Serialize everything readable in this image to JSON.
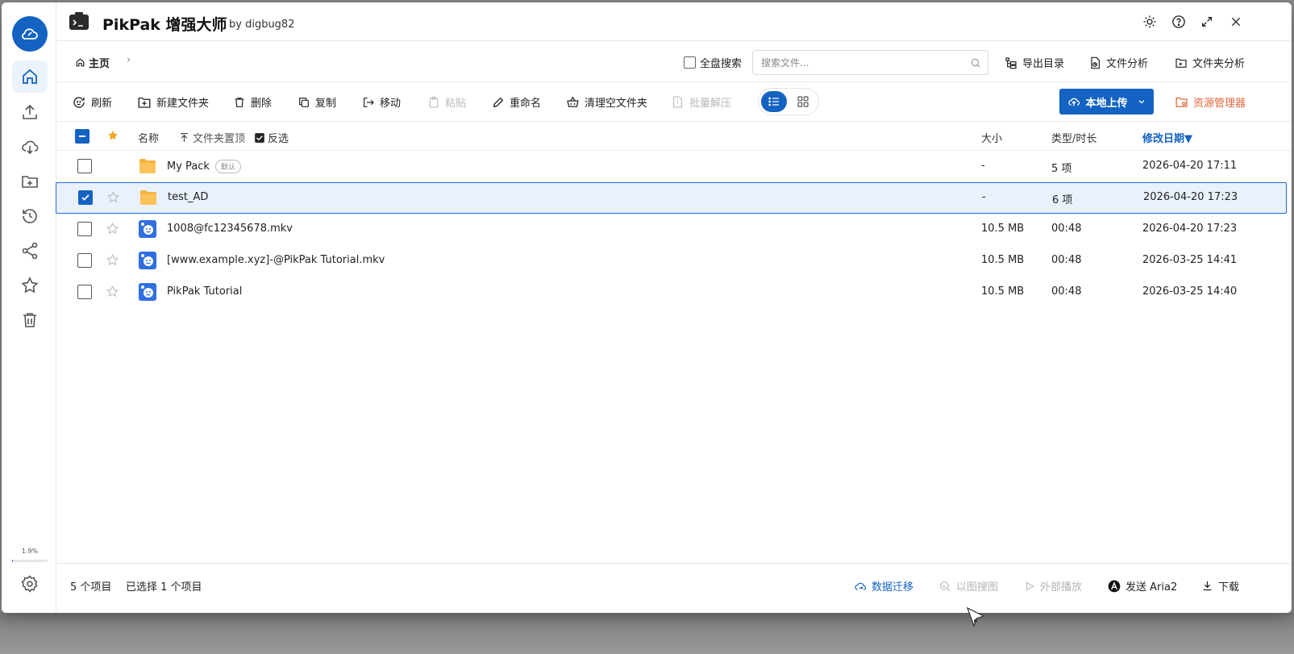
{
  "app": {
    "title": "PikPak 增强大师",
    "author": "by digbug82"
  },
  "sidebar": {
    "items": [
      {
        "name": "home",
        "icon": "home-icon",
        "active": true
      },
      {
        "name": "upload",
        "icon": "upload-icon"
      },
      {
        "name": "cloud-download",
        "icon": "cloud-download-icon"
      },
      {
        "name": "new-folder",
        "icon": "folder-plus-icon"
      },
      {
        "name": "history",
        "icon": "history-icon"
      },
      {
        "name": "share",
        "icon": "share-icon"
      },
      {
        "name": "favorites",
        "icon": "star-icon"
      },
      {
        "name": "trash",
        "icon": "trash-icon"
      }
    ],
    "usage_label": "1.9%",
    "usage_fraction": 0.019
  },
  "nav": {
    "home_label": "主页",
    "crumb_sep": "›",
    "full_disk_search": "全盘搜索",
    "search_placeholder": "搜索文件...",
    "export_dir": "导出目录",
    "file_analysis": "文件分析",
    "folder_analysis": "文件夹分析"
  },
  "toolbar": {
    "refresh": "刷新",
    "new_folder": "新建文件夹",
    "delete": "删除",
    "copy": "复制",
    "move": "移动",
    "paste": "粘贴",
    "rename": "重命名",
    "clean_empty": "清理空文件夹",
    "batch_extract": "批量解压",
    "upload": "本地上传",
    "explorer": "资源管理器"
  },
  "table": {
    "headers": {
      "name": "名称",
      "pin_folders": "文件夹置顶",
      "invert": "反选",
      "size": "大小",
      "type": "类型/时长",
      "modified": "修改日期▼"
    },
    "rows": [
      {
        "name": "My Pack",
        "tag": "默认",
        "kind": "folder",
        "size": "-",
        "type": "5 项",
        "date": "2026-04-20 17:11",
        "checked": false,
        "star": false
      },
      {
        "name": "test_AD",
        "tag": "",
        "kind": "folder",
        "size": "-",
        "type": "6 项",
        "date": "2026-04-20 17:23",
        "checked": true,
        "star": true
      },
      {
        "name": "1008@fc12345678.mkv",
        "tag": "",
        "kind": "video",
        "size": "10.5 MB",
        "type": "00:48",
        "date": "2026-04-20 17:23",
        "checked": false,
        "star": true
      },
      {
        "name": "[www.example.xyz]-@PikPak Tutorial.mkv",
        "tag": "",
        "kind": "video",
        "size": "10.5 MB",
        "type": "00:48",
        "date": "2026-03-25 14:41",
        "checked": false,
        "star": true
      },
      {
        "name": "PikPak Tutorial",
        "tag": "",
        "kind": "video",
        "size": "10.5 MB",
        "type": "00:48",
        "date": "2026-03-25 14:40",
        "checked": false,
        "star": true
      }
    ]
  },
  "footer": {
    "item_count": "5 个项目",
    "selected_count": "已选择 1 个项目",
    "data_migration": "数据迁移",
    "image_search": "以图搜图",
    "external_play": "外部播放",
    "send_aria2": "发送 Aria2",
    "download": "下载"
  },
  "colors": {
    "accent": "#1463c2",
    "explorer": "#e0663a",
    "folder": "#f5b33e",
    "selected_row": "#e8f1fc"
  }
}
